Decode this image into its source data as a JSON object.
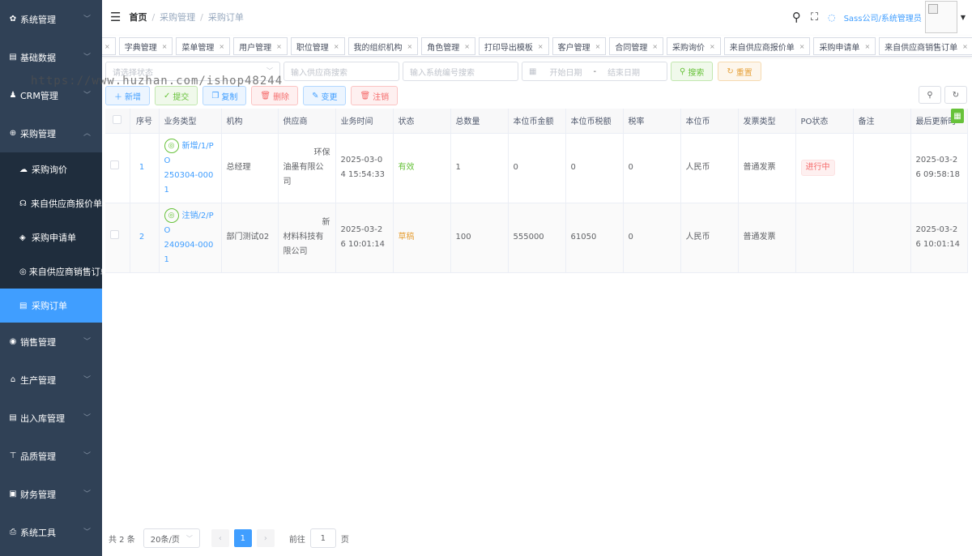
{
  "sidebar": {
    "items": [
      {
        "label": "系统管理",
        "icon": "gear-icon"
      },
      {
        "label": "基础数据",
        "icon": "list-icon"
      },
      {
        "label": "CRM管理",
        "icon": "people-icon"
      },
      {
        "label": "采购管理",
        "icon": "globe-icon"
      }
    ],
    "sub_items": [
      {
        "label": "采购询价",
        "icon": "wechat-icon"
      },
      {
        "label": "来自供应商报价单",
        "icon": "headset-icon"
      },
      {
        "label": "采购申请单",
        "icon": "shield-icon"
      },
      {
        "label": "来自供应商销售订单",
        "icon": "tag-icon"
      },
      {
        "label": "采购订单",
        "icon": "list-icon"
      }
    ],
    "items_after": [
      {
        "label": "销售管理",
        "icon": "chrome-icon"
      },
      {
        "label": "生产管理",
        "icon": "home-icon"
      },
      {
        "label": "出入库管理",
        "icon": "list-icon"
      },
      {
        "label": "品质管理",
        "icon": "tree-icon"
      },
      {
        "label": "财务管理",
        "icon": "monitor-icon"
      },
      {
        "label": "系统工具",
        "icon": "print-icon"
      }
    ]
  },
  "breadcrumb": {
    "home": "首页",
    "level1": "采购管理",
    "level2": "采购订单"
  },
  "header": {
    "user": "Sass公司/系统管理员"
  },
  "tags": [
    "字典管理",
    "菜单管理",
    "用户管理",
    "职位管理",
    "我的组织机构",
    "角色管理",
    "打印导出模板",
    "客户管理",
    "合同管理",
    "采购询价",
    "来自供应商报价单",
    "采购申请单",
    "来自供应商销售订单"
  ],
  "active_tag": "采购订单",
  "filters": {
    "status_placeholder": "请选择状态",
    "supplier_placeholder": "输入供应商搜索",
    "sysno_placeholder": "输入系统编号搜索",
    "start_date": "开始日期",
    "date_sep": "-",
    "end_date": "结束日期",
    "search": "搜索",
    "reset": "重置"
  },
  "toolbar": {
    "add": "新增",
    "submit": "提交",
    "copy": "复制",
    "delete": "删除",
    "change": "变更",
    "cancel": "注销"
  },
  "table": {
    "headers": [
      "序号",
      "业务类型",
      "机构",
      "供应商",
      "业务时间",
      "状态",
      "总数量",
      "本位币金额",
      "本位币税额",
      "税率",
      "本位币",
      "发票类型",
      "PO状态",
      "备注",
      "最后更新时"
    ],
    "rows": [
      {
        "idx": "1",
        "type": "新增/1/PO",
        "type_no": "250304-0001",
        "org": "总经理",
        "supplier": "环保",
        "supplier2": "油墨有限公司",
        "time": "2025-03-04 15:54:33",
        "status": "有效",
        "qty": "1",
        "amount": "0",
        "tax": "0",
        "rate": "0",
        "currency": "人民币",
        "invoice": "普通发票",
        "po_status": "进行中",
        "remark": "",
        "updated": "2025-03-26 09:58:18"
      },
      {
        "idx": "2",
        "type": "注销/2/PO",
        "type_no": "240904-0001",
        "org": "部门测试02",
        "supplier": "新",
        "supplier2": "材料科技有限公司",
        "time": "2025-03-26 10:01:14",
        "status": "草稿",
        "qty": "100",
        "amount": "555000",
        "tax": "61050",
        "rate": "0",
        "currency": "人民币",
        "invoice": "普通发票",
        "po_status": "",
        "remark": "",
        "updated": "2025-03-26 10:01:14"
      }
    ]
  },
  "pagination": {
    "total": "共 2 条",
    "page_size": "20条/页",
    "current": "1",
    "goto": "前往",
    "goto_value": "1",
    "page_unit": "页"
  },
  "watermark": "https://www.huzhan.com/ishop48244",
  "colors": {
    "sidebar_bg": "#304156",
    "accent": "#409eff",
    "active_tag": "#42b983"
  }
}
